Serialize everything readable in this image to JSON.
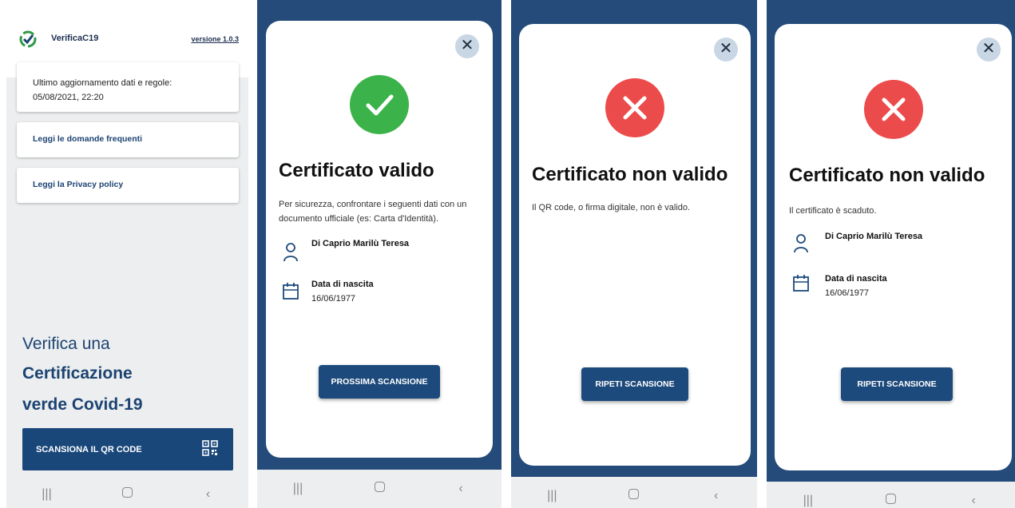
{
  "home": {
    "app_name": "VerificaC19",
    "version": "versione 1.0.3",
    "update_label": "Ultimo aggiornamento dati e regole:",
    "update_date": "05/08/2021, 22:20",
    "faq_link": "Leggi le domande frequenti",
    "privacy_link": "Leggi la Privacy policy",
    "headline_1": "Verifica una",
    "headline_2": "Certificazione",
    "headline_3": "verde Covid-19",
    "scan_button": "SCANSIONA IL QR CODE",
    "scan_icon": "qr-code-icon",
    "brand_color": "#1c4372"
  },
  "result_valid": {
    "close": "✕",
    "status_icon": "check-icon",
    "status_color": "#3bb34a",
    "title": "Certificato valido",
    "description": "Per sicurezza, confrontare i seguenti dati con un documento ufficiale (es: Carta d'Identità).",
    "name": "Di Caprio Marilù Teresa",
    "birth_label": "Data di nascita",
    "birth_date": "16/06/1977",
    "button": "PROSSIMA SCANSIONE"
  },
  "result_invalid_signature": {
    "close": "✕",
    "status_icon": "x-icon",
    "status_color": "#ec4b4b",
    "title": "Certificato non valido",
    "description": "Il QR code, o firma digitale, non è valido.",
    "button": "RIPETI SCANSIONE"
  },
  "result_expired": {
    "close": "✕",
    "status_icon": "x-icon",
    "status_color": "#ec4b4b",
    "title": "Certificato non valido",
    "description": "Il certificato è scaduto.",
    "name": "Di Caprio Marilù Teresa",
    "birth_label": "Data di nascita",
    "birth_date": "16/06/1977",
    "button": "RIPETI SCANSIONE"
  },
  "nav": {
    "recents": "|||",
    "back": "‹"
  }
}
